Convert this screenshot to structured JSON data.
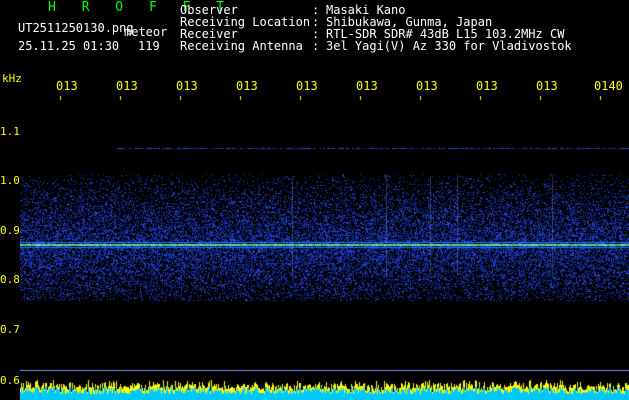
{
  "station": {
    "title": "H R O F F T",
    "filename": "UT2511250130.png",
    "mode": "meteor",
    "timestamp": "25.11.25 01:30",
    "count": "119"
  },
  "info": [
    {
      "label": "Observer",
      "value": "Masaki Kano"
    },
    {
      "label": "Receiving Location",
      "value": "Shibukawa, Gunma, Japan"
    },
    {
      "label": "Receiver",
      "value": "RTL-SDR SDR# 43dB L15 103.2MHz CW"
    },
    {
      "label": "Receiving Antenna",
      "value": "3el Yagi(V) Az 330 for Vladivostok"
    }
  ],
  "axis": {
    "y_unit": "kHz",
    "y_ticks": [
      "1.1",
      "1.0",
      "0.9",
      "0.8",
      "0.7",
      "0.6"
    ],
    "x_ticks": [
      "013",
      "013",
      "013",
      "013",
      "013",
      "013",
      "013",
      "013",
      "013",
      "0140"
    ]
  },
  "colors": {
    "label": "#ffff00",
    "title": "#00ff00",
    "background": "#000000",
    "noise": "#1a3cff",
    "signal": "#7dff7d"
  }
}
